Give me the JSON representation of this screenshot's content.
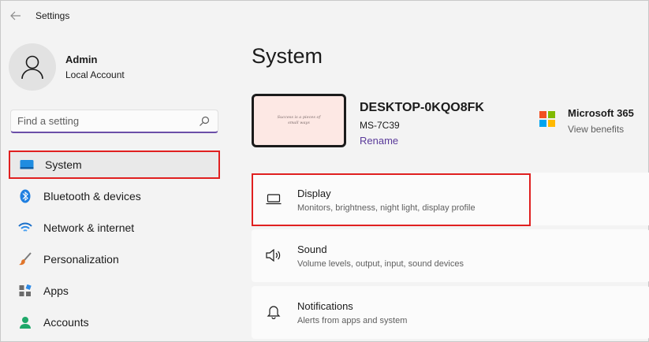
{
  "window": {
    "title": "Settings"
  },
  "profile": {
    "name": "Admin",
    "account_type": "Local Account"
  },
  "search": {
    "placeholder": "Find a setting"
  },
  "sidebar": {
    "items": [
      {
        "label": "System",
        "icon": "system-icon",
        "active": true
      },
      {
        "label": "Bluetooth & devices",
        "icon": "bluetooth-icon"
      },
      {
        "label": "Network & internet",
        "icon": "wifi-icon"
      },
      {
        "label": "Personalization",
        "icon": "brush-icon"
      },
      {
        "label": "Apps",
        "icon": "apps-icon"
      },
      {
        "label": "Accounts",
        "icon": "person-icon"
      }
    ]
  },
  "main": {
    "title": "System",
    "device": {
      "name": "DESKTOP-0KQO8FK",
      "model": "MS-7C39",
      "rename_label": "Rename",
      "wallpaper_text": "Success is a pieces of small ways"
    },
    "promo": {
      "title": "Microsoft 365",
      "subtitle": "View benefits"
    },
    "cards": [
      {
        "title": "Display",
        "subtitle": "Monitors, brightness, night light, display profile",
        "icon": "monitor-icon"
      },
      {
        "title": "Sound",
        "subtitle": "Volume levels, output, input, sound devices",
        "icon": "speaker-icon"
      },
      {
        "title": "Notifications",
        "subtitle": "Alerts from apps and system",
        "icon": "bell-icon"
      }
    ]
  },
  "colors": {
    "accent": "#6b4fa8",
    "highlight_border": "#e02020",
    "link": "#5a3a9a",
    "background": "#f3f3f3",
    "card": "#fbfbfb"
  }
}
